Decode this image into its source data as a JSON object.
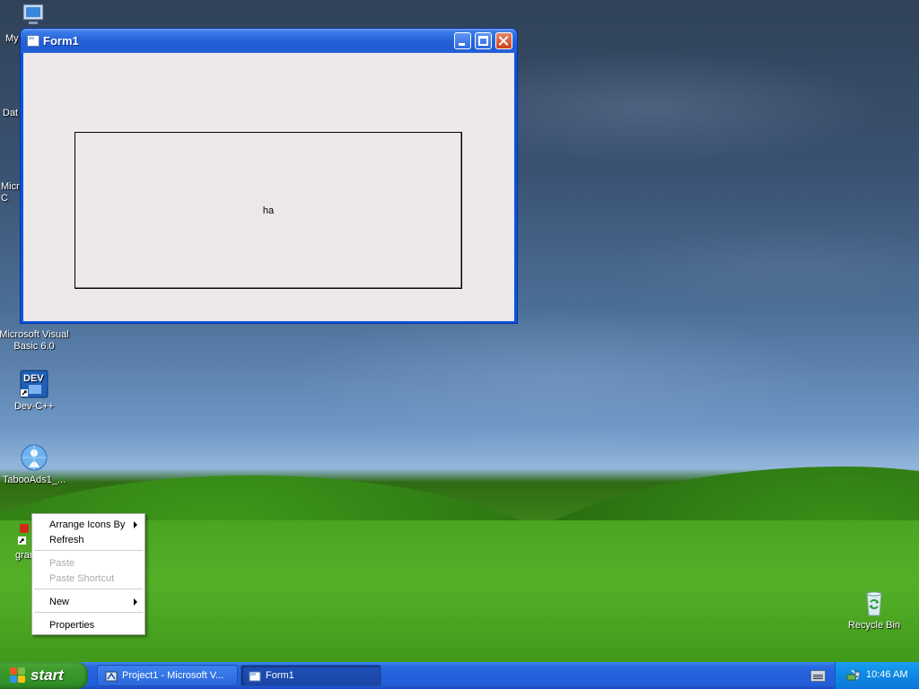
{
  "desktop": {
    "icons": [
      {
        "label": "My",
        "icon": "computer-icon"
      },
      {
        "label": "Dat",
        "icon": "data-icon"
      },
      {
        "label": "Micro\nC",
        "icon": "app-icon"
      },
      {
        "label": "Microsoft Visual\nBasic 6.0",
        "icon": "vb6-icon"
      },
      {
        "label": "Dev-C++",
        "icon": "devcpp-icon",
        "badge": "DEV"
      },
      {
        "label": "TabooAds1_...",
        "icon": "globe-user-icon"
      },
      {
        "label": "grar",
        "icon": "app-shortcut-icon"
      },
      {
        "label": "Recycle Bin",
        "icon": "recycle-bin-icon"
      }
    ]
  },
  "window": {
    "title": "Form1",
    "frame_text": "ha"
  },
  "context_menu": {
    "items": [
      {
        "label": "Arrange Icons By",
        "submenu": true,
        "enabled": true
      },
      {
        "label": "Refresh",
        "submenu": false,
        "enabled": true
      },
      {
        "label": "Paste",
        "submenu": false,
        "enabled": false
      },
      {
        "label": "Paste Shortcut",
        "submenu": false,
        "enabled": false
      },
      {
        "label": "New",
        "submenu": true,
        "enabled": true
      },
      {
        "label": "Properties",
        "submenu": false,
        "enabled": true
      }
    ]
  },
  "taskbar": {
    "start_label": "start",
    "tasks": [
      {
        "label": "Project1 - Microsoft V...",
        "active": false
      },
      {
        "label": "Form1",
        "active": true
      }
    ],
    "clock": "10:46 AM"
  },
  "colors": {
    "titlebar": "#2562d8",
    "taskbar": "#245fdb",
    "start_button": "#3c9a2c",
    "tray": "#0f87e3"
  }
}
